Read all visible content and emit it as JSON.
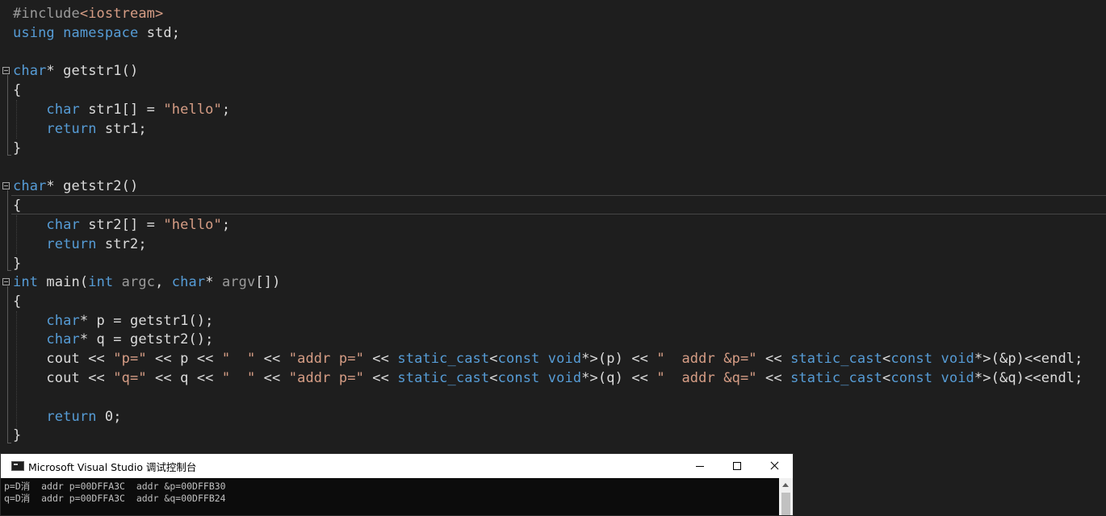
{
  "editor": {
    "lines": {
      "l1": {
        "pp": "#include",
        "inc": "<iostream>"
      },
      "l2": {
        "kw1": "using",
        "kw2": "namespace",
        "rest": " std;"
      },
      "f1": {
        "kw": "char",
        "rest": "* getstr1()"
      },
      "f1_open": "{",
      "f1_b1": {
        "kw": "char",
        "a": " str1[] = ",
        "str": "\"hello\"",
        "b": ";"
      },
      "f1_b2": {
        "kw": "return",
        "rest": " str1;"
      },
      "f1_close": "}",
      "f2": {
        "kw": "char",
        "rest": "* getstr2()"
      },
      "f2_open": "{",
      "f2_b1": {
        "kw": "char",
        "a": " str2[] = ",
        "str": "\"hello\"",
        "b": ";"
      },
      "f2_b2": {
        "kw": "return",
        "rest": " str2;"
      },
      "f2_close": "}",
      "m": {
        "kw1": "int",
        "a": " main(",
        "kw2": "int",
        "p1": " argc",
        "b": ", ",
        "kw3": "char",
        "c": "* ",
        "p2": "argv",
        "d": "[])"
      },
      "m_open": "{",
      "m_b1": {
        "kw": "char",
        "rest": "* p = getstr1();"
      },
      "m_b2": {
        "kw": "char",
        "rest": "* q = getstr2();"
      },
      "m_b3": {
        "a": "cout << ",
        "s1": "\"p=\"",
        "b": " << p << ",
        "s2": "\"  \"",
        "c": " << ",
        "s3": "\"addr p=\"",
        "d": " << ",
        "k1": "static_cast",
        "e": "<",
        "k2": "const",
        "f": " ",
        "k3": "void",
        "g": "*>(p) << ",
        "s4": "\"  addr &p=\"",
        "h": " << ",
        "k4": "static_cast",
        "i": "<",
        "k5": "const",
        "j": " ",
        "k6": "void",
        "k": "*>(&p)<<endl;"
      },
      "m_b4": {
        "a": "cout << ",
        "s1": "\"q=\"",
        "b": " << q << ",
        "s2": "\"  \"",
        "c": " << ",
        "s3": "\"addr p=\"",
        "d": " << ",
        "k1": "static_cast",
        "e": "<",
        "k2": "const",
        "f": " ",
        "k3": "void",
        "g": "*>(q) << ",
        "s4": "\"  addr &q=\"",
        "h": " << ",
        "k4": "static_cast",
        "i": "<",
        "k5": "const",
        "j": " ",
        "k6": "void",
        "k": "*>(&q)<<endl;"
      },
      "m_b5": {
        "kw": "return",
        "rest": " 0;"
      },
      "m_close": "}"
    }
  },
  "console": {
    "title": "Microsoft Visual Studio 调试控制台",
    "icon": "console-app-icon",
    "output": [
      "p=D消  addr p=00DFFA3C  addr &p=00DFFB30",
      "q=D消  addr p=00DFFA3C  addr &q=00DFFB24"
    ]
  },
  "colors": {
    "background": "#1e1e1e",
    "keyword": "#569cd6",
    "string": "#d69d85",
    "text": "#dcdcdc",
    "preprocessor": "#9b9b9b",
    "parameter": "#9a9a9a"
  }
}
